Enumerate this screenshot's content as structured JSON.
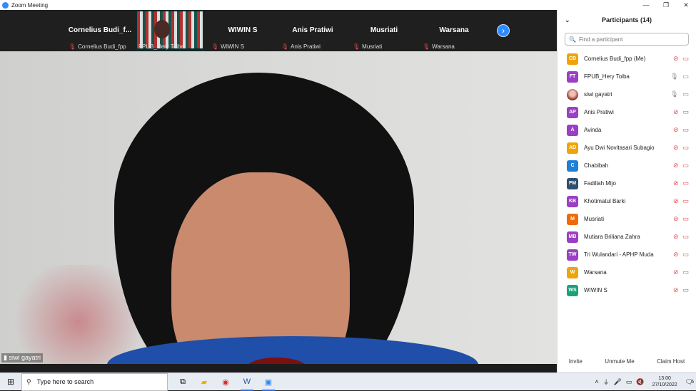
{
  "window": {
    "title": "Zoom Meeting"
  },
  "strip": {
    "tiles": [
      {
        "big": "Cornelius  Budi_f...",
        "small": "Cornelius Budi_fpp",
        "muted": true
      },
      {
        "big": "",
        "small": "FPUB_Hery Toiba",
        "muted": true,
        "video": true
      },
      {
        "big": "WIWIN S",
        "small": "WIWIN S",
        "muted": true
      },
      {
        "big": "Anis Pratiwi",
        "small": "Anis Pratiwi",
        "muted": true
      },
      {
        "big": "Musriati",
        "small": "Musriati",
        "muted": true
      },
      {
        "big": "Warsana",
        "small": "Warsana",
        "muted": true
      }
    ]
  },
  "main": {
    "speaker_label": "siwi gayatri"
  },
  "panel": {
    "title": "Participants (14)",
    "search_placeholder": "Find a participant",
    "participants": [
      {
        "initials": "CB",
        "name": "Cornelius Budi_fpp (Me)",
        "color": "#f0a30a",
        "muted": true
      },
      {
        "initials": "FT",
        "name": "FPUB_Hery Toiba",
        "color": "#9b3fc4",
        "muted": false
      },
      {
        "initials": "",
        "name": "siwi gayatri",
        "color": "#c04040",
        "muted": false,
        "photo": true
      },
      {
        "initials": "AP",
        "name": "Anis Pratiwi",
        "color": "#9b3fc4",
        "muted": true
      },
      {
        "initials": "A",
        "name": "Avinda",
        "color": "#9b3fc4",
        "muted": true
      },
      {
        "initials": "AD",
        "name": "Ayu Dwi Novitasari Subagio",
        "color": "#f0a30a",
        "muted": true
      },
      {
        "initials": "C",
        "name": "Chabibah",
        "color": "#1e7fd6",
        "muted": true
      },
      {
        "initials": "FM",
        "name": "Fadillah Mijo",
        "color": "#2f4f6f",
        "muted": true
      },
      {
        "initials": "KB",
        "name": "Khotimatul Barki",
        "color": "#9b3fc4",
        "muted": true
      },
      {
        "initials": "M",
        "name": "Musriati",
        "color": "#f06a0a",
        "muted": true
      },
      {
        "initials": "MB",
        "name": "Mutiara Briliana Zahra",
        "color": "#9b3fc4",
        "muted": true
      },
      {
        "initials": "TW",
        "name": "Tri Wulandari - APHP Muda",
        "color": "#9b3fc4",
        "muted": true
      },
      {
        "initials": "W",
        "name": "Warsana",
        "color": "#f0a30a",
        "muted": true
      },
      {
        "initials": "WS",
        "name": "WIWIN S",
        "color": "#1aa37a",
        "muted": true
      }
    ],
    "actions": {
      "invite": "Invite",
      "unmute": "Unmute Me",
      "claim": "Claim Host"
    }
  },
  "taskbar": {
    "search_text": "Type here to search",
    "time": "13:00",
    "date": "27/10/2022",
    "notification_count": "6"
  }
}
